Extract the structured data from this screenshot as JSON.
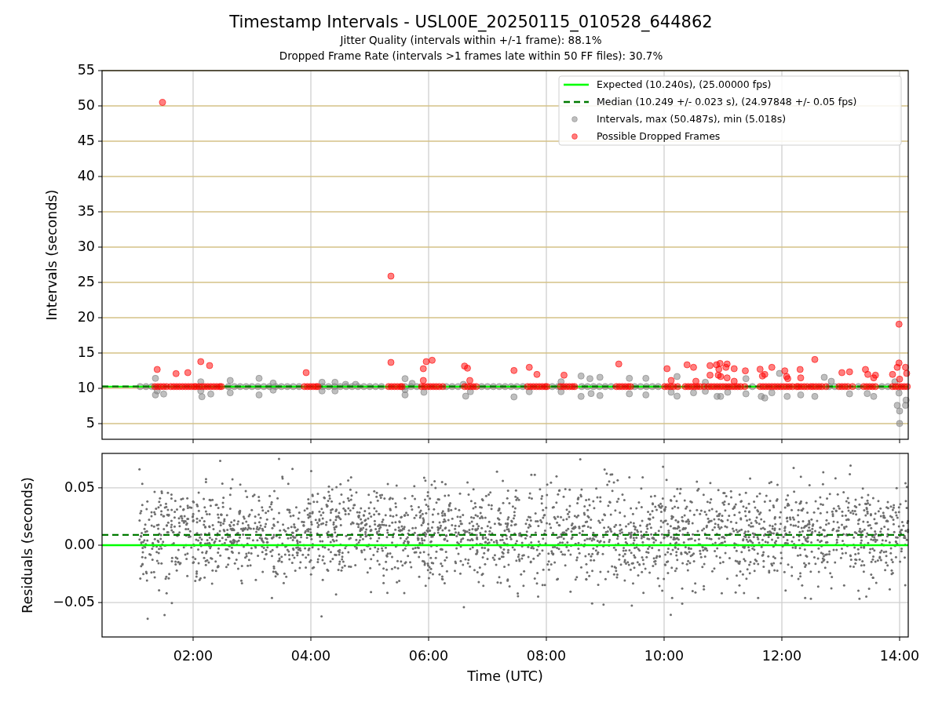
{
  "figure": {
    "title": "Timestamp Intervals - USL00E_20250115_010528_644862",
    "subtitles": [
      "Jitter Quality (intervals within +/-1 frame): 88.1%",
      "Dropped Frame Rate (intervals >1 frames late within 50 FF files): 30.7%"
    ]
  },
  "plots": [
    {
      "chart_data": {
        "type": "scatter",
        "ylabel": "Intervals (seconds)",
        "xlim": [
          0.4533,
          14.1467
        ],
        "ylim": [
          2.78,
          55
        ],
        "grid": true,
        "legend": "upper right",
        "yticks": [
          {
            "value": 5,
            "label": "5"
          },
          {
            "value": 10,
            "label": "10"
          },
          {
            "value": 15,
            "label": "15"
          },
          {
            "value": 20,
            "label": "20"
          },
          {
            "value": 25,
            "label": "25"
          },
          {
            "value": 30,
            "label": "30"
          },
          {
            "value": 35,
            "label": "35"
          },
          {
            "value": 40,
            "label": "40"
          },
          {
            "value": 45,
            "label": "45"
          },
          {
            "value": 50,
            "label": "50"
          },
          {
            "value": 55,
            "label": "55"
          }
        ],
        "ref_lines": [
          {
            "axis": "y",
            "value": 10.24,
            "label": "Expected (10.240s), (25.00000 fps)",
            "color": "#00ff00"
          },
          {
            "axis": "y",
            "value": 10.249,
            "label": "Median (10.249 +/- 0.023 s), (24.97848 +/- 0.05 fps)",
            "color": "#007a00"
          }
        ],
        "series": [
          {
            "name": "Intervals, max (50.487s), min (5.018s)",
            "color": "#808080",
            "x": [
              1.1,
              1.2,
              1.3,
              2.6,
              2.7,
              2.8,
              2.9,
              3.0,
              3.1,
              3.2,
              3.3,
              3.4,
              3.5,
              3.6,
              3.7,
              3.8,
              4.2,
              4.3,
              4.4,
              4.5,
              4.6,
              4.7,
              4.8,
              4.9,
              5.0,
              5.1,
              5.2,
              5.6,
              5.7,
              5.8,
              6.3,
              6.4,
              6.5,
              6.9,
              7.0,
              7.1,
              7.2,
              7.3,
              7.4,
              7.5,
              7.6,
              8.1,
              8.2,
              8.6,
              8.7,
              8.8,
              8.9,
              9.0,
              9.1,
              9.5,
              9.6,
              9.7,
              9.8,
              9.9,
              11.5,
              12.8,
              12.9,
              13.3,
              13.7,
              13.8,
              1.36,
              1.36,
              1.5,
              1.39,
              2.13,
              2.15,
              2.3,
              2.13,
              2.63,
              2.63,
              3.12,
              3.12,
              3.36,
              3.36,
              4.19,
              4.19,
              4.41,
              4.41,
              4.59,
              4.76,
              5.6,
              5.6,
              5.72,
              5.6,
              5.92,
              6.63,
              6.71,
              6.59,
              7.45,
              7.71,
              8.25,
              8.25,
              8.59,
              8.59,
              8.74,
              8.76,
              8.91,
              8.91,
              9.41,
              9.41,
              9.69,
              9.69,
              10.22,
              10.22,
              10.12,
              10.5,
              10.7,
              10.7,
              10.9,
              10.96,
              11.08,
              11.39,
              11.39,
              11.65,
              11.71,
              11.83,
              11.96,
              12.09,
              12.32,
              12.56,
              12.72,
              12.84,
              13.15,
              13.56,
              13.45,
              13.96,
              14.0,
              14.11,
              14.1,
              14.0,
              13.92,
              13.99
            ],
            "values": [
              10.24,
              10.24,
              10.24,
              10.24,
              10.24,
              10.24,
              10.24,
              10.24,
              10.24,
              10.24,
              10.24,
              10.24,
              10.24,
              10.24,
              10.24,
              10.24,
              10.24,
              10.24,
              10.24,
              10.24,
              10.24,
              10.24,
              10.24,
              10.24,
              10.24,
              10.24,
              10.24,
              10.24,
              10.24,
              10.24,
              10.24,
              10.24,
              10.24,
              10.24,
              10.24,
              10.24,
              10.24,
              10.24,
              10.24,
              10.24,
              10.24,
              10.24,
              10.24,
              10.24,
              10.24,
              10.24,
              10.24,
              10.24,
              10.24,
              10.24,
              10.24,
              10.24,
              10.24,
              10.24,
              10.24,
              10.24,
              10.24,
              10.24,
              10.24,
              10.24,
              11.41,
              9.07,
              9.19,
              9.63,
              10.93,
              8.81,
              9.19,
              9.63,
              11.11,
              9.37,
              11.41,
              9.07,
              10.74,
              9.74,
              10.85,
              9.63,
              10.85,
              9.63,
              10.56,
              10.56,
              11.37,
              9.07,
              10.7,
              9.81,
              9.44,
              8.89,
              9.52,
              10.56,
              8.78,
              9.52,
              10.93,
              9.52,
              11.74,
              8.85,
              11.37,
              9.26,
              11.56,
              8.97,
              11.41,
              9.22,
              11.41,
              9.07,
              11.67,
              8.89,
              9.44,
              9.37,
              10.85,
              9.59,
              8.85,
              8.85,
              9.44,
              11.37,
              9.22,
              8.85,
              8.63,
              9.37,
              12.11,
              8.85,
              9.07,
              8.85,
              11.56,
              11.0,
              9.22,
              8.85,
              9.26,
              7.59,
              6.78,
              8.33,
              7.59,
              5.02,
              10.93,
              9.33
            ]
          },
          {
            "name": "Possible Dropped Frames",
            "color": "#ff0000",
            "x": [
              1.48,
              5.36,
              13.99,
              1.39,
              1.71,
              1.91,
              2.13,
              2.28,
              3.92,
              5.36,
              5.91,
              5.96,
              6.06,
              5.91,
              6.61,
              6.66,
              6.7,
              7.45,
              7.71,
              7.84,
              8.3,
              9.23,
              10.05,
              10.12,
              10.39,
              10.5,
              10.54,
              10.78,
              10.78,
              10.89,
              10.95,
              11.07,
              11.05,
              10.93,
              10.92,
              10.96,
              11.07,
              11.19,
              11.19,
              11.38,
              11.63,
              11.67,
              11.71,
              11.83,
              12.05,
              12.08,
              12.1,
              12.31,
              12.32,
              12.56,
              13.02,
              13.15,
              13.42,
              13.46,
              13.56,
              13.59,
              13.99,
              13.96,
              14.1,
              13.88,
              14.0,
              14.12,
              1.35,
              1.4,
              1.45,
              1.5,
              1.55,
              1.62,
              1.67,
              1.72,
              1.77,
              1.82,
              1.87,
              1.92,
              1.97,
              2.02,
              2.05,
              2.1,
              2.15,
              2.2,
              2.25,
              2.3,
              2.35,
              2.4,
              2.45,
              2.48,
              3.89,
              3.94,
              3.99,
              4.04,
              4.09,
              4.12,
              5.32,
              5.37,
              5.42,
              5.47,
              5.52,
              5.55,
              5.88,
              5.93,
              5.98,
              6.03,
              6.08,
              6.13,
              6.18,
              6.24,
              6.61,
              6.66,
              6.71,
              6.76,
              6.81,
              7.68,
              7.73,
              7.78,
              7.83,
              7.88,
              7.93,
              7.98,
              8.01,
              8.24,
              8.29,
              8.34,
              8.39,
              8.44,
              8.48,
              9.19,
              9.24,
              9.29,
              9.34,
              9.39,
              9.43,
              10.01,
              10.06,
              10.11,
              10.16,
              10.23,
              10.36,
              10.41,
              10.46,
              10.51,
              10.56,
              10.61,
              10.68,
              10.75,
              10.8,
              10.85,
              10.9,
              10.95,
              11.0,
              11.05,
              11.1,
              11.15,
              11.2,
              11.25,
              11.3,
              11.37,
              11.63,
              11.68,
              11.73,
              11.78,
              11.83,
              11.88,
              11.93,
              11.98,
              12.03,
              12.08,
              12.13,
              12.18,
              12.25,
              12.28,
              12.33,
              12.38,
              12.43,
              12.49,
              12.53,
              12.58,
              12.63,
              12.68,
              12.75,
              12.97,
              13.02,
              13.07,
              13.12,
              13.2,
              13.39,
              13.44,
              13.49,
              13.54,
              13.59,
              13.88,
              13.93,
              13.98,
              14.03,
              14.08,
              14.13
            ],
            "values": [
              50.49,
              25.89,
              19.08,
              12.67,
              12.08,
              12.22,
              13.78,
              13.22,
              12.22,
              13.67,
              12.78,
              13.78,
              13.97,
              11.11,
              13.15,
              12.85,
              11.11,
              12.52,
              12.97,
              11.97,
              11.86,
              13.44,
              12.78,
              11.11,
              13.33,
              12.97,
              11.0,
              13.22,
              11.86,
              13.33,
              13.52,
              13.44,
              12.97,
              12.7,
              11.86,
              11.67,
              11.48,
              12.78,
              11.0,
              12.48,
              12.7,
              11.74,
              11.97,
              12.97,
              12.48,
              11.67,
              11.37,
              12.67,
              11.48,
              14.08,
              12.22,
              12.33,
              12.67,
              11.97,
              11.48,
              11.86,
              13.59,
              12.97,
              12.97,
              11.97,
              11.3,
              12.11,
              10.24,
              10.24,
              10.24,
              10.24,
              10.24,
              10.24,
              10.24,
              10.24,
              10.24,
              10.24,
              10.24,
              10.24,
              10.24,
              10.24,
              10.24,
              10.24,
              10.24,
              10.24,
              10.24,
              10.24,
              10.24,
              10.24,
              10.24,
              10.24,
              10.24,
              10.24,
              10.24,
              10.24,
              10.24,
              10.24,
              10.24,
              10.24,
              10.24,
              10.24,
              10.24,
              10.24,
              10.24,
              10.24,
              10.24,
              10.24,
              10.24,
              10.24,
              10.24,
              10.24,
              10.24,
              10.24,
              10.24,
              10.24,
              10.24,
              10.24,
              10.24,
              10.24,
              10.24,
              10.24,
              10.24,
              10.24,
              10.24,
              10.24,
              10.24,
              10.24,
              10.24,
              10.24,
              10.24,
              10.24,
              10.24,
              10.24,
              10.24,
              10.24,
              10.24,
              10.24,
              10.24,
              10.24,
              10.24,
              10.24,
              10.24,
              10.24,
              10.24,
              10.24,
              10.24,
              10.24,
              10.24,
              10.24,
              10.24,
              10.24,
              10.24,
              10.24,
              10.24,
              10.24,
              10.24,
              10.24,
              10.24,
              10.24,
              10.24,
              10.24,
              10.24,
              10.24,
              10.24,
              10.24,
              10.24,
              10.24,
              10.24,
              10.24,
              10.24,
              10.24,
              10.24,
              10.24,
              10.24,
              10.24,
              10.24,
              10.24,
              10.24,
              10.24,
              10.24,
              10.24,
              10.24,
              10.24,
              10.24,
              10.24,
              10.24,
              10.24,
              10.24,
              10.24,
              10.24,
              10.24,
              10.24,
              10.24,
              10.24,
              10.24,
              10.24,
              10.24,
              10.24,
              10.24,
              10.24
            ]
          }
        ]
      }
    },
    {
      "chart_data": {
        "type": "scatter",
        "xlabel": "Time (UTC)",
        "ylabel": "Residuals (seconds)",
        "xlim": [
          0.4533,
          14.1467
        ],
        "ylim": [
          -0.08,
          0.08
        ],
        "grid": true,
        "xticks": [
          {
            "value": 2,
            "label": "02:00"
          },
          {
            "value": 4,
            "label": "04:00"
          },
          {
            "value": 6,
            "label": "06:00"
          },
          {
            "value": 8,
            "label": "08:00"
          },
          {
            "value": 10,
            "label": "10:00"
          },
          {
            "value": 12,
            "label": "12:00"
          },
          {
            "value": 14,
            "label": "14:00"
          }
        ],
        "yticks": [
          {
            "value": -0.05,
            "label": "−0.05"
          },
          {
            "value": 0,
            "label": "0.00"
          },
          {
            "value": 0.05,
            "label": "0.05"
          }
        ],
        "ref_lines": [
          {
            "axis": "y",
            "value": 0,
            "color": "#00ff00"
          },
          {
            "axis": "y",
            "value": 0.009,
            "color": "#007a00"
          }
        ]
      }
    }
  ]
}
